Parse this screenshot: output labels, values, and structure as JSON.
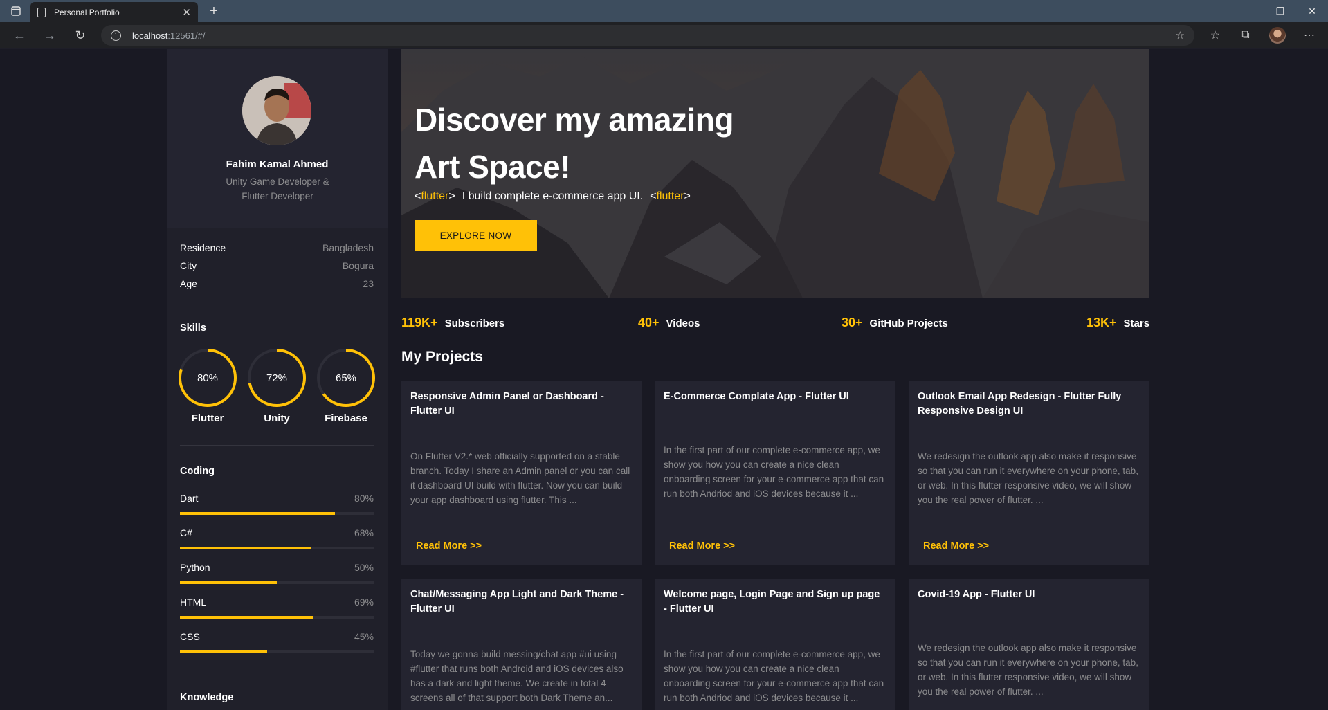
{
  "browser": {
    "tab_title": "Personal Portfolio",
    "url_host": "localhost",
    "url_rest": ":12561/#/"
  },
  "profile": {
    "name": "Fahim Kamal Ahmed",
    "role_line1": "Unity Game Developer &",
    "role_line2": "Flutter Developer"
  },
  "info": [
    {
      "key": "Residence",
      "value": "Bangladesh"
    },
    {
      "key": "City",
      "value": "Bogura"
    },
    {
      "key": "Age",
      "value": "23"
    }
  ],
  "skills": {
    "title": "Skills",
    "items": [
      {
        "label": "Flutter",
        "percent": 0.8,
        "text": "80%"
      },
      {
        "label": "Unity",
        "percent": 0.72,
        "text": "72%"
      },
      {
        "label": "Firebase",
        "percent": 0.65,
        "text": "65%"
      }
    ]
  },
  "coding": {
    "title": "Coding",
    "items": [
      {
        "label": "Dart",
        "percent": 0.8,
        "text": "80%"
      },
      {
        "label": "C#",
        "percent": 0.68,
        "text": "68%"
      },
      {
        "label": "Python",
        "percent": 0.5,
        "text": "50%"
      },
      {
        "label": "HTML",
        "percent": 0.69,
        "text": "69%"
      },
      {
        "label": "CSS",
        "percent": 0.45,
        "text": "45%"
      }
    ]
  },
  "knowledge": {
    "title": "Knowledge"
  },
  "hero": {
    "title_line1": "Discover my amazing",
    "title_line2": "Art Space!",
    "tag_open": "<",
    "tag_name": "flutter",
    "tag_close": ">",
    "tagline": "I build complete e-commerce app UI.",
    "button": "EXPLORE NOW"
  },
  "stats": [
    {
      "num": "119K+",
      "label": "Subscribers"
    },
    {
      "num": "40+",
      "label": "Videos"
    },
    {
      "num": "30+",
      "label": "GitHub Projects"
    },
    {
      "num": "13K+",
      "label": "Stars"
    }
  ],
  "projects": {
    "title": "My Projects",
    "read_more": "Read More >>",
    "items": [
      {
        "title": "Responsive Admin Panel or Dashboard - Flutter UI",
        "desc": "On Flutter V2.* web officially supported on a stable branch. Today I share an Admin panel or you can call it dashboard UI build with flutter. Now you can build your app dashboard using flutter. This ..."
      },
      {
        "title": "E-Commerce Complate App - Flutter UI",
        "desc": "In the first part of our complete e-commerce app, we show you how you can create a nice clean onboarding screen for your e-commerce app that can run both Andriod and iOS devices because it ..."
      },
      {
        "title": "Outlook Email App Redesign - Flutter Fully Responsive Design UI",
        "desc": "We redesign the outlook app also make it responsive so that you can run it everywhere on your phone, tab, or web. In this flutter responsive video, we will show you the real power of flutter. ..."
      },
      {
        "title": "Chat/Messaging App Light and Dark Theme - Flutter UI",
        "desc": "Today we gonna build messing/chat app #ui using #flutter that runs both Android and iOS devices also has a dark and light theme. We create in total 4 screens all of that support both Dark Theme an..."
      },
      {
        "title": "Welcome page, Login Page and Sign up page - Flutter UI",
        "desc": "In the first part of our complete e-commerce app, we show you how you can create a nice clean onboarding screen for your e-commerce app that can run both Andriod and iOS devices because it ..."
      },
      {
        "title": "Covid-19 App - Flutter UI",
        "desc": "We redesign the outlook app also make it responsive so that you can run it everywhere on your phone, tab, or web. In this flutter responsive video, we will show you the real power of flutter. ..."
      }
    ]
  },
  "colors": {
    "accent": "#ffc107",
    "background": "#191923",
    "sidebar": "#20202a",
    "card": "#242430"
  }
}
